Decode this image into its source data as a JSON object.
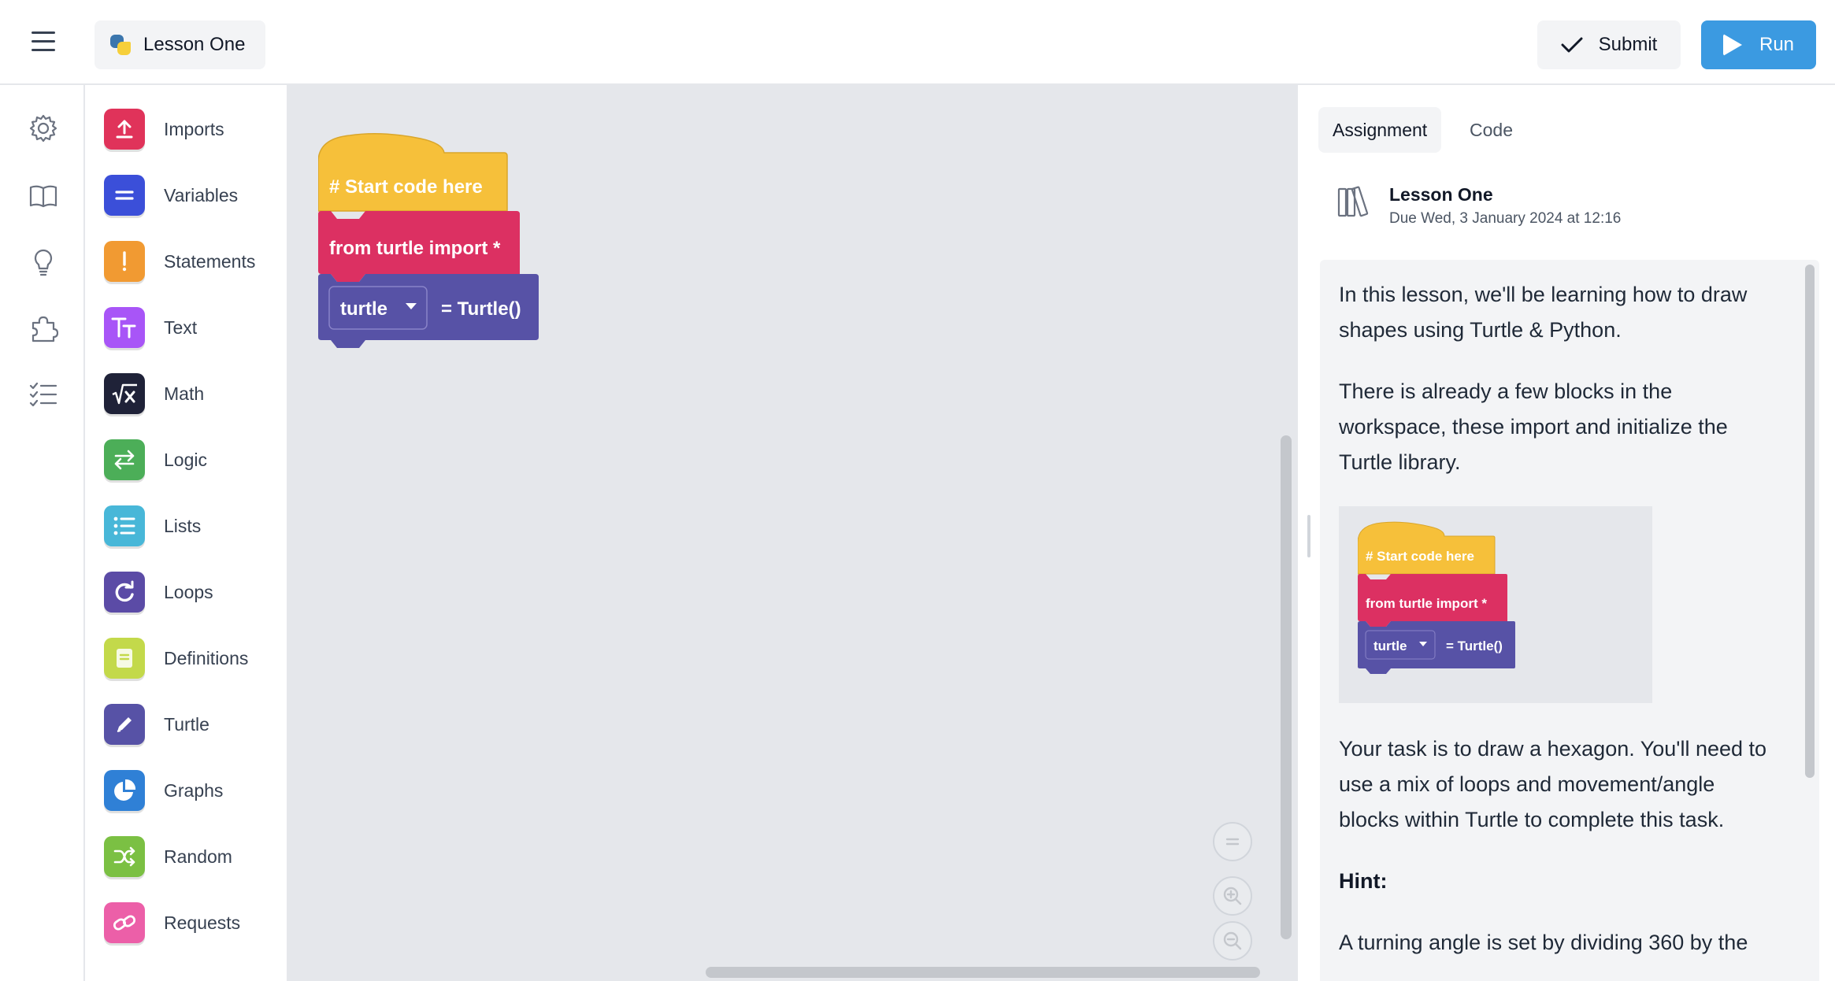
{
  "header": {
    "lesson_tab_label": "Lesson One",
    "submit_label": "Submit",
    "run_label": "Run",
    "run_color": "#3b9ae1"
  },
  "rail": {
    "icons": [
      "gear-icon",
      "book-icon",
      "lightbulb-icon",
      "puzzle-icon",
      "checklist-icon"
    ]
  },
  "toolbox": {
    "categories": [
      {
        "label": "Imports",
        "color": "#e0335a",
        "icon": "upload-icon"
      },
      {
        "label": "Variables",
        "color": "#3b4fd9",
        "icon": "equals-icon"
      },
      {
        "label": "Statements",
        "color": "#f19a32",
        "icon": "exclamation-icon"
      },
      {
        "label": "Text",
        "color": "#a855f7",
        "icon": "text-icon"
      },
      {
        "label": "Math",
        "color": "#1f2238",
        "icon": "sqrt-icon"
      },
      {
        "label": "Logic",
        "color": "#4cae58",
        "icon": "arrows-icon"
      },
      {
        "label": "Lists",
        "color": "#48b7d8",
        "icon": "list-icon"
      },
      {
        "label": "Loops",
        "color": "#5b4ba6",
        "icon": "loop-icon"
      },
      {
        "label": "Definitions",
        "color": "#c3d94a",
        "icon": "document-icon"
      },
      {
        "label": "Turtle",
        "color": "#5752a6",
        "icon": "pencil-icon"
      },
      {
        "label": "Graphs",
        "color": "#2f80d6",
        "icon": "pie-icon"
      },
      {
        "label": "Random",
        "color": "#7bc043",
        "icon": "shuffle-icon"
      },
      {
        "label": "Requests",
        "color": "#ec5fa8",
        "icon": "link-icon"
      }
    ]
  },
  "workspace": {
    "blocks": {
      "comment": "# Start code here",
      "import": "from turtle import *",
      "var_name": "turtle",
      "assign": "= Turtle()"
    },
    "block_colors": {
      "comment": "#f6c03a",
      "import": "#dc3062",
      "assign": "#5752a6"
    }
  },
  "panel": {
    "tabs": [
      "Assignment",
      "Code"
    ],
    "assignment_title": "Lesson One",
    "due": "Due Wed, 3 January 2024 at 12:16",
    "paragraph1": "In this lesson, we'll be learning how to draw shapes using Turtle & Python.",
    "paragraph2": "There is already a few blocks in the workspace, these import and initialize the Turtle library.",
    "embed_blocks": {
      "comment": "# Start code here",
      "import": "from turtle import *",
      "var_name": "turtle",
      "assign": "= Turtle()"
    },
    "paragraph3": "Your task is to draw a hexagon. You'll need to use a mix of loops and movement/angle blocks within Turtle to complete this task.",
    "hint_label": "Hint:",
    "paragraph4": "A turning angle is set by dividing 360 by the"
  }
}
